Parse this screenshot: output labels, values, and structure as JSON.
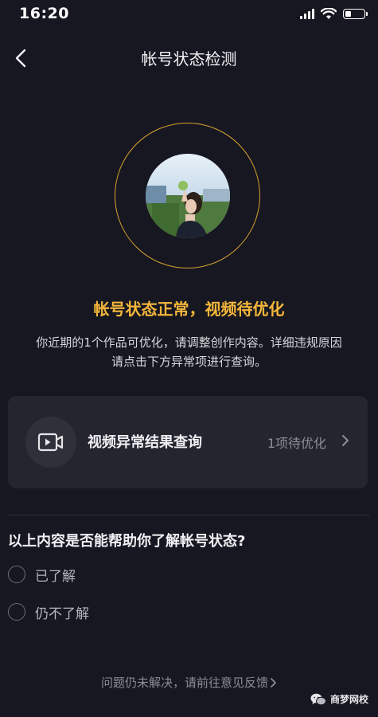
{
  "status_bar": {
    "time": "16:20",
    "battery_level": 0.35
  },
  "nav": {
    "title": "帐号状态检测",
    "back_icon": "chevron-left-icon"
  },
  "status": {
    "headline": "帐号状态正常，视频待优化",
    "description_line1": "你近期的1个作品可优化，请调整创作内容。详细违规原因",
    "description_line2": "请点击下方异常项进行查询。"
  },
  "card": {
    "icon": "video-camera-icon",
    "title": "视频异常结果查询",
    "badge": "1项待优化"
  },
  "survey": {
    "question": "以上内容是否能帮助你了解帐号状态?",
    "options": [
      {
        "label": "已了解"
      },
      {
        "label": "仍不了解"
      }
    ]
  },
  "footer": {
    "link_text": "问题仍未解决，请前往意见反馈"
  },
  "watermark": {
    "text": "商梦网校"
  },
  "colors": {
    "background": "#171721",
    "accent": "#f4b63a",
    "ring": "#d9a22e",
    "card": "#24252f"
  }
}
